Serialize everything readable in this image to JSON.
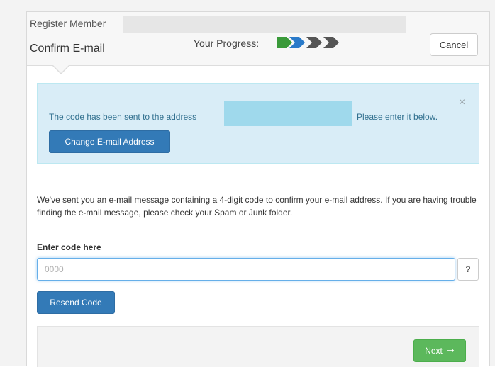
{
  "header": {
    "register_label": "Register Member",
    "step_title": "Confirm E-mail",
    "progress_label": "Your Progress:",
    "progress": {
      "current_step": 2,
      "total_steps": 4,
      "completed_color": "#3a9a3a",
      "current_color": "#2a7ac9",
      "pending_color": "#555555"
    },
    "cancel_label": "Cancel"
  },
  "alert": {
    "text_before": "The code has been sent to the address",
    "text_after": "Please enter it below.",
    "close_glyph": "×",
    "change_email_label": "Change E-mail Address"
  },
  "main": {
    "info_text": "We've sent you an e-mail message containing a 4-digit code to confirm your e-mail address. If you are having trouble finding the e-mail message, please check your Spam or Junk folder.",
    "code_label": "Enter code here",
    "code_placeholder": "0000",
    "code_value": "",
    "help_label": "?",
    "resend_label": "Resend Code"
  },
  "footer": {
    "next_label": "Next",
    "next_arrow": "➞"
  },
  "colors": {
    "primary": "#337ab7",
    "success": "#5cb85c",
    "info_bg": "#d9edf7",
    "info_text": "#31708f"
  }
}
